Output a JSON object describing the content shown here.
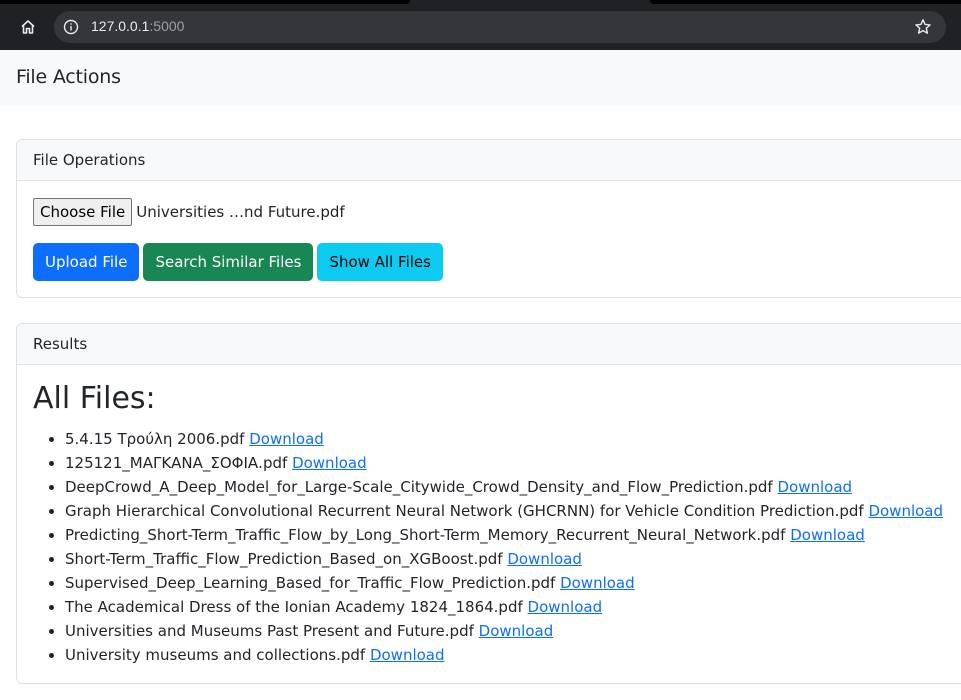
{
  "browser": {
    "url_host": "127.0.0.1",
    "url_port": ":5000",
    "icons": {
      "home": "home-icon",
      "info": "info-icon",
      "bookmark": "star-icon"
    }
  },
  "navbar": {
    "brand": "File Actions"
  },
  "operations": {
    "header": "File Operations",
    "choose_file_label": "Choose File",
    "selected_file": "Universities …nd Future.pdf",
    "upload_label": "Upload File",
    "search_label": "Search Similar Files",
    "show_all_label": "Show All Files"
  },
  "results": {
    "header": "Results",
    "title": "All Files:",
    "files": [
      {
        "name": "5.4.15 Τρούλη 2006.pdf",
        "link": "Download"
      },
      {
        "name": "125121_ΜΑΓΚΑΝΑ_ΣΟΦΙΑ.pdf",
        "link": "Download"
      },
      {
        "name": "DeepCrowd_A_Deep_Model_for_Large-Scale_Citywide_Crowd_Density_and_Flow_Prediction.pdf",
        "link": "Download"
      },
      {
        "name": "Graph Hierarchical Convolutional Recurrent Neural Network (GHCRNN) for Vehicle Condition Prediction.pdf",
        "link": "Download"
      },
      {
        "name": "Predicting_Short-Term_Traffic_Flow_by_Long_Short-Term_Memory_Recurrent_Neural_Network.pdf",
        "link": "Download"
      },
      {
        "name": "Short-Term_Traffic_Flow_Prediction_Based_on_XGBoost.pdf",
        "link": "Download"
      },
      {
        "name": "Supervised_Deep_Learning_Based_for_Traffic_Flow_Prediction.pdf",
        "link": "Download"
      },
      {
        "name": "The Academical Dress of the Ionian Academy 1824_1864.pdf",
        "link": "Download"
      },
      {
        "name": "Universities and Museums Past Present and Future.pdf",
        "link": "Download"
      },
      {
        "name": "University museums and collections.pdf",
        "link": "Download"
      }
    ]
  },
  "colors": {
    "primary": "#0d6efd",
    "success": "#198754",
    "info": "#0dcaf0",
    "chrome_bg": "#202124"
  }
}
